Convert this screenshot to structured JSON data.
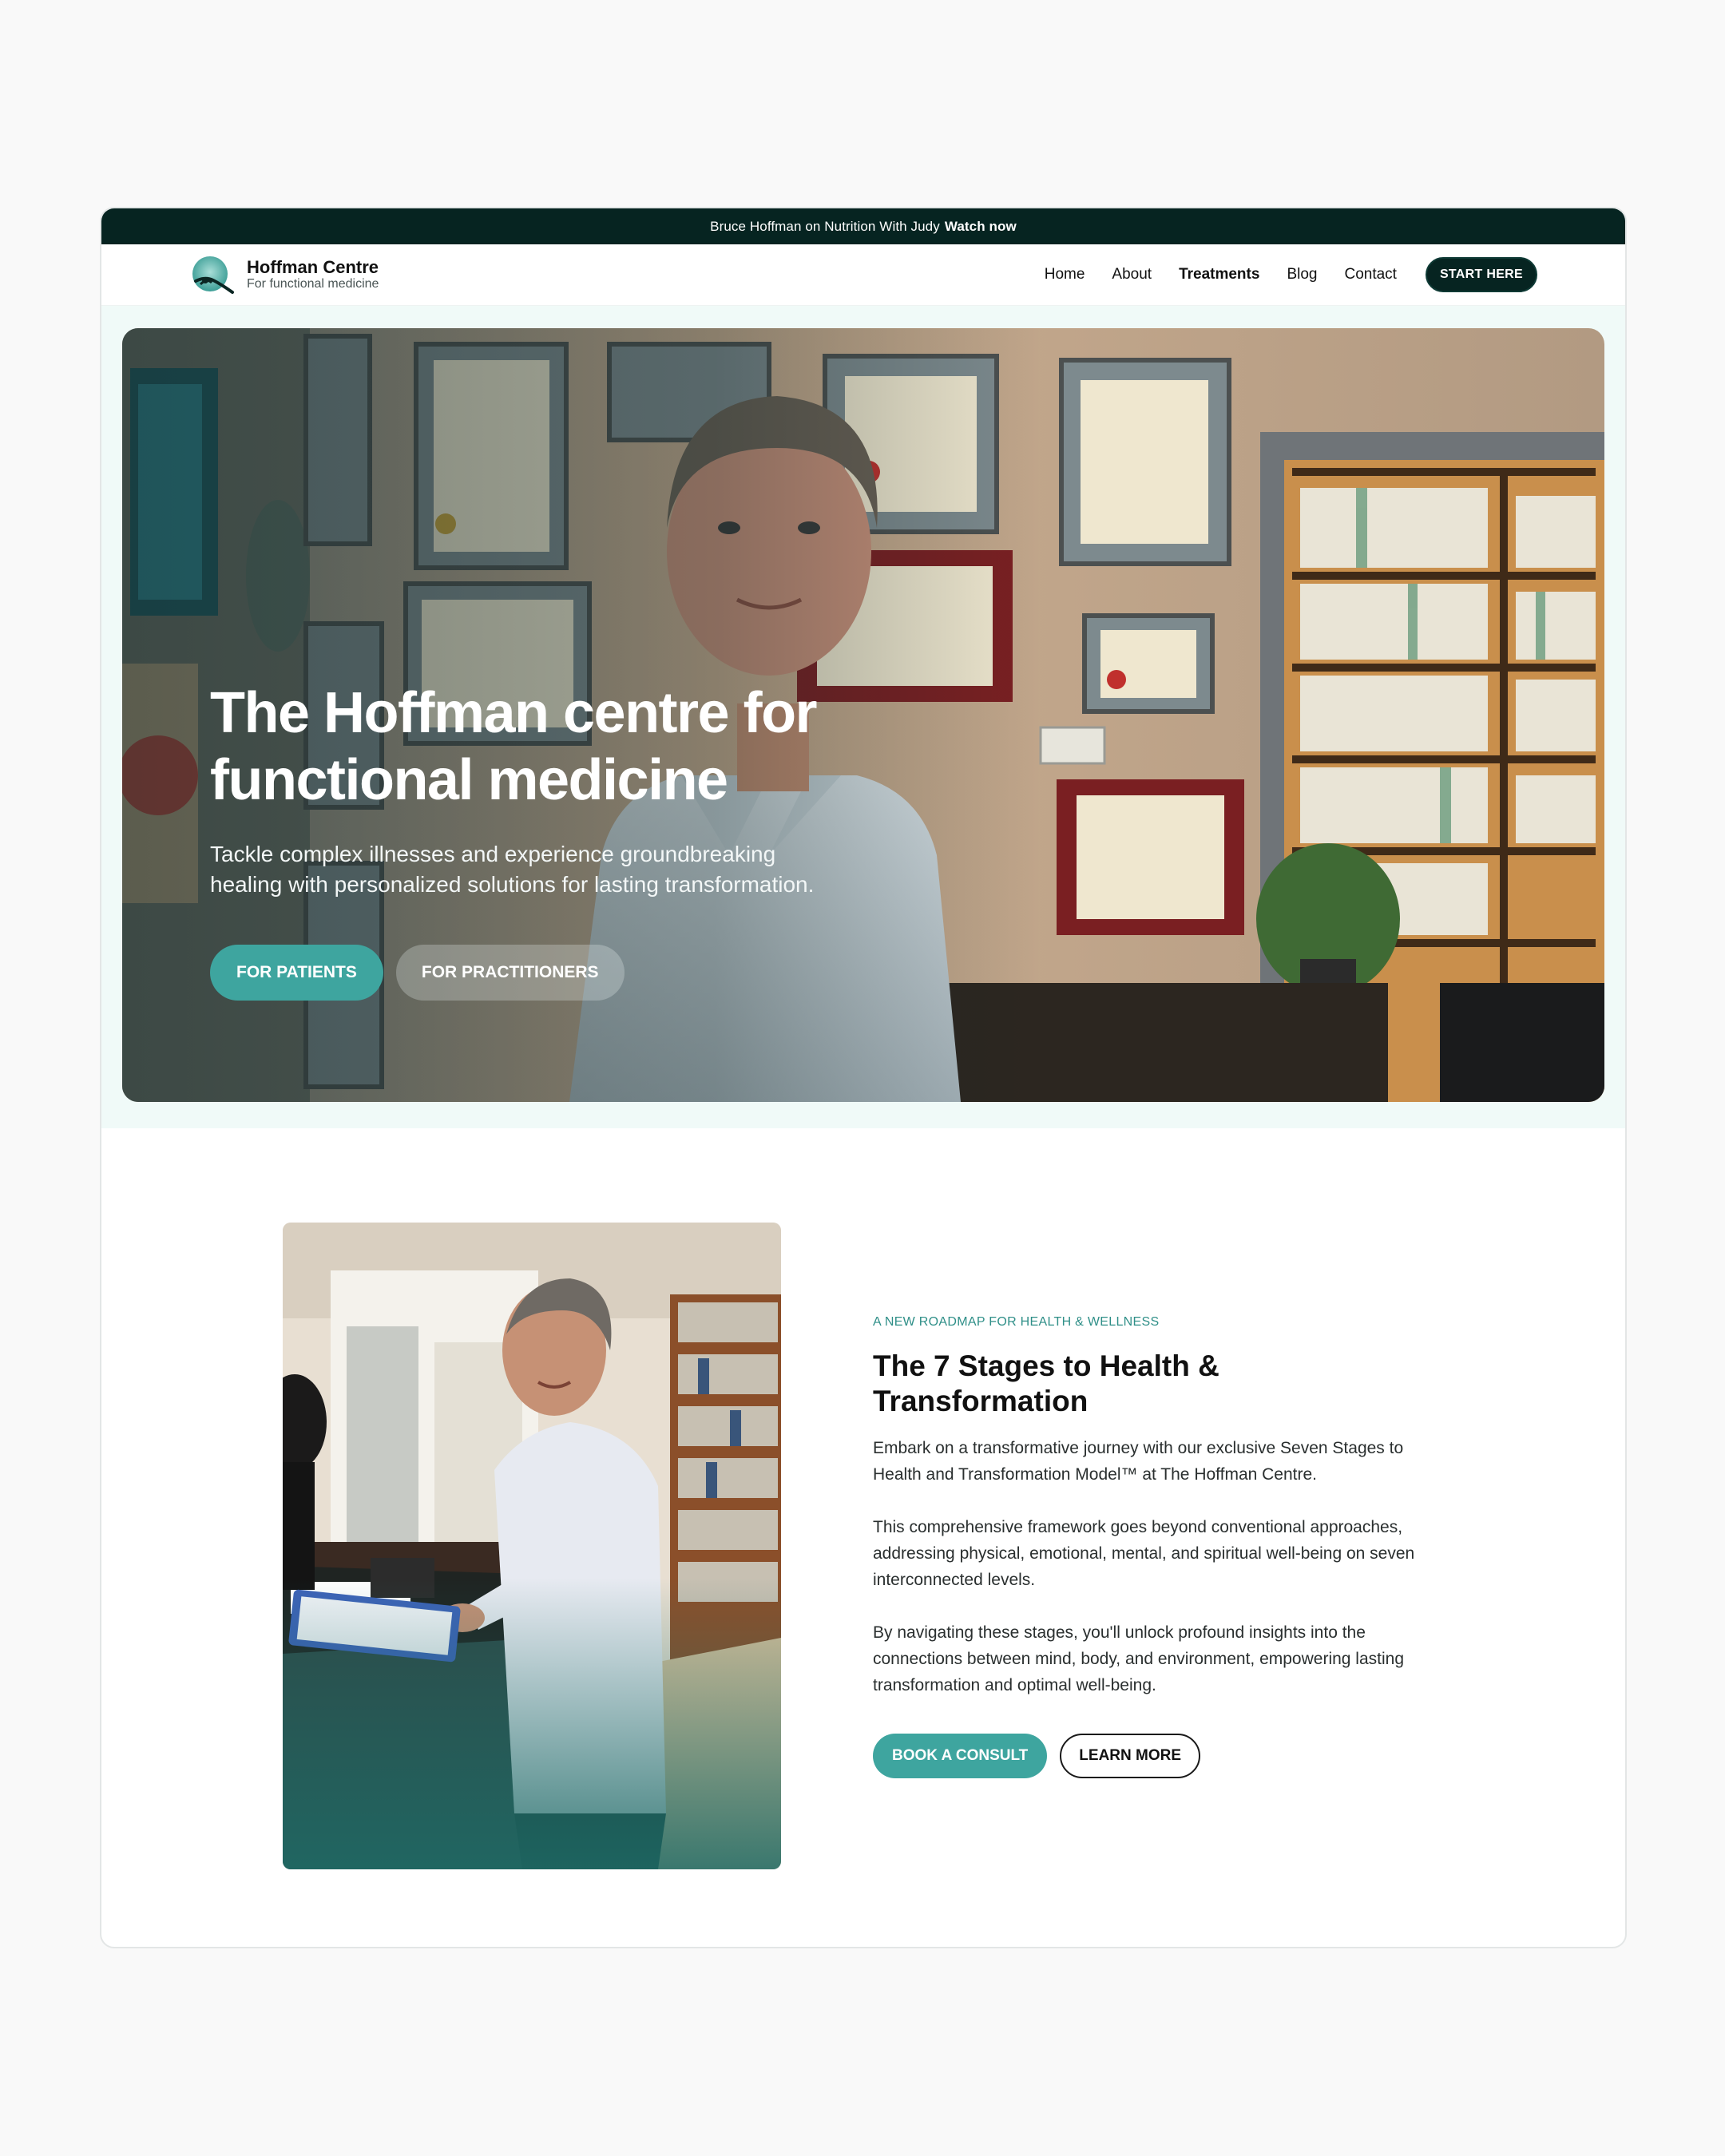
{
  "announcement": {
    "text": "Bruce Hoffman on Nutrition With Judy",
    "link": "Watch now"
  },
  "brand": {
    "name": "Hoffman Centre",
    "tagline": "For functional medicine",
    "logo_icon": "hoffman-logo-icon"
  },
  "nav": {
    "links": [
      {
        "label": "Home"
      },
      {
        "label": "About"
      },
      {
        "label": "Treatments"
      },
      {
        "label": "Blog"
      },
      {
        "label": "Contact"
      }
    ],
    "active": "Treatments",
    "cta": "START HERE"
  },
  "hero": {
    "title_line1": "The Hoffman centre for",
    "title_line2": "functional medicine",
    "subtitle": "Tackle complex illnesses and experience groundbreaking healing with personalized solutions for lasting transformation.",
    "btn_patients": "FOR PATIENTS",
    "btn_practitioners": "FOR PRACTITIONERS"
  },
  "stages": {
    "eyebrow": "A NEW ROADMAP FOR HEALTH & WELLNESS",
    "title": "The 7 Stages to Health & Transformation",
    "paragraphs": [
      "Embark on a transformative journey with our exclusive Seven Stages to Health and Transformation Model™ at The Hoffman Centre.",
      " This comprehensive framework goes beyond conventional approaches, addressing physical, emotional, mental, and spiritual well-being on seven interconnected levels.",
      "By navigating these stages, you'll unlock profound insights into the connections between mind, body, and environment, empowering lasting transformation and optimal well-being."
    ],
    "btn_consult": "BOOK A CONSULT",
    "btn_learn": "LEARN MORE"
  },
  "colors": {
    "dark": "#062421",
    "teal": "#3ea59f",
    "hero_bg": "#f0faf8"
  }
}
